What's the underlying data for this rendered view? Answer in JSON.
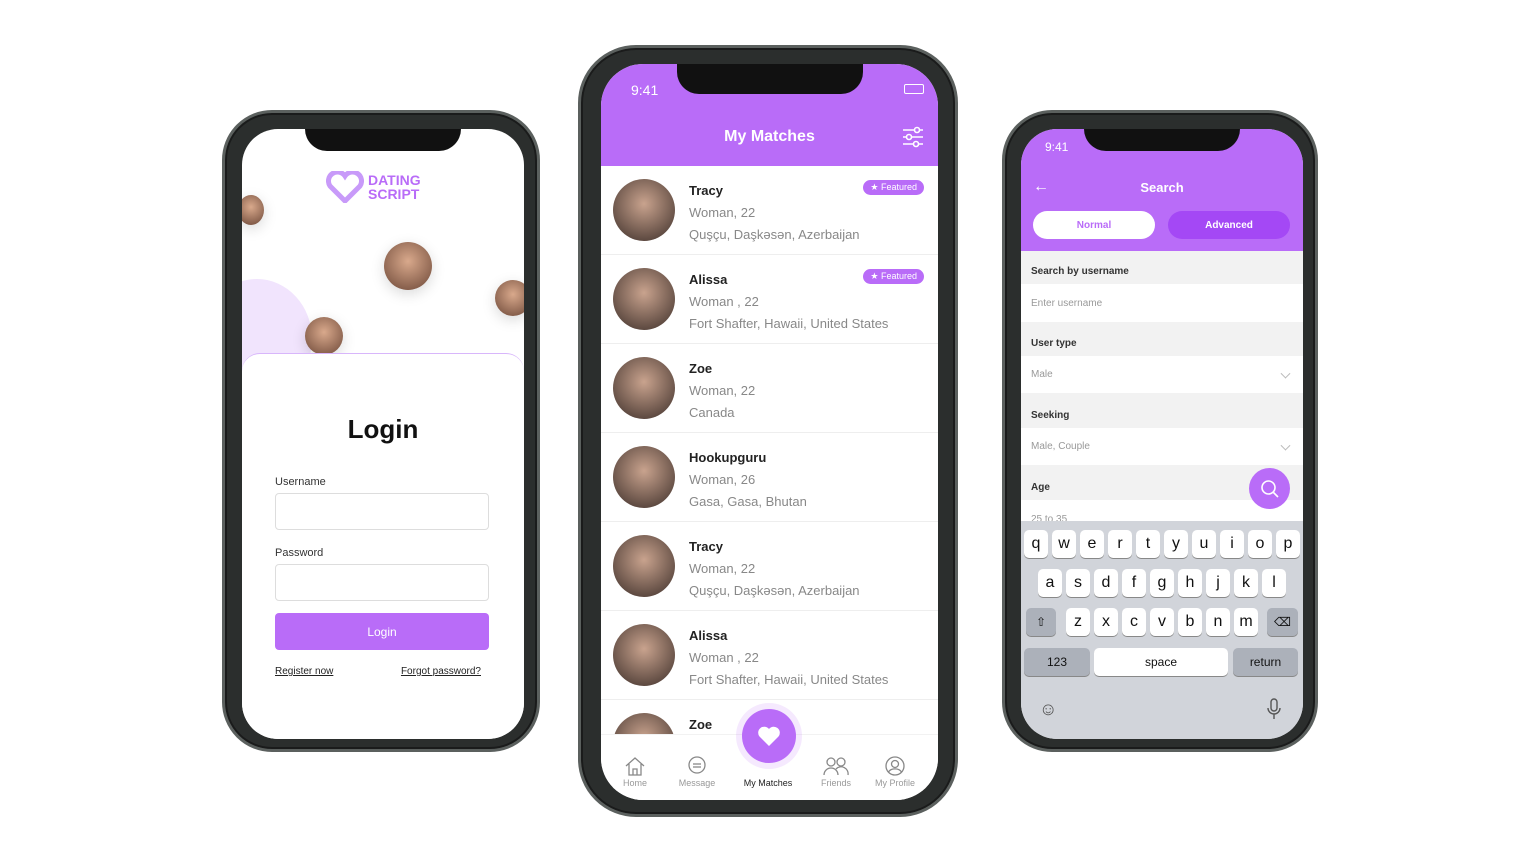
{
  "login_screen": {
    "logo_line1": "DATING",
    "logo_line2": "SCRIPT",
    "title": "Login",
    "username_label": "Username",
    "password_label": "Password",
    "login_button": "Login",
    "register_link": "Register now",
    "forgot_link": "Forgot password?"
  },
  "matches_screen": {
    "time": "9:41",
    "title": "My Matches",
    "icons": {
      "filter": "sliders-icon",
      "fab": "heart-icon"
    },
    "featured_label": "★ Featured",
    "items": [
      {
        "name": "Tracy",
        "detail": "Woman,  22",
        "location": "Quşçu, Daşkəsən, Azerbaijan",
        "featured": true
      },
      {
        "name": "Alissa",
        "detail": "Woman ,  22",
        "location": "Fort Shafter, Hawaii, United States",
        "featured": true
      },
      {
        "name": "Zoe",
        "detail": "Woman,  22",
        "location": "Canada",
        "featured": false
      },
      {
        "name": "Hookupguru",
        "detail": "Woman,  26",
        "location": "Gasa, Gasa, Bhutan",
        "featured": false
      },
      {
        "name": "Tracy",
        "detail": "Woman,  22",
        "location": "Quşçu, Daşkəsən, Azerbaijan",
        "featured": false
      },
      {
        "name": "Alissa",
        "detail": "Woman ,  22",
        "location": "Fort Shafter, Hawaii, United States",
        "featured": false
      },
      {
        "name": "Zoe",
        "detail": "",
        "location": "",
        "featured": false
      }
    ],
    "tabs": [
      {
        "label": "Home"
      },
      {
        "label": "Message"
      },
      {
        "label": "My Matches"
      },
      {
        "label": "Friends"
      },
      {
        "label": "My Profile"
      }
    ],
    "active_tab": "My Matches"
  },
  "search_screen": {
    "time": "9:41",
    "title": "Search",
    "tab_normal": "Normal",
    "tab_advanced": "Advanced",
    "active_tab": "Normal",
    "username_label": "Search by username",
    "username_placeholder": "Enter username",
    "usertype_label": "User type",
    "usertype_value": "Male",
    "seeking_label": "Seeking",
    "seeking_value": "Male, Couple",
    "age_label": "Age",
    "age_value": "25 to 35",
    "keyboard": {
      "row1": [
        "q",
        "w",
        "e",
        "r",
        "t",
        "y",
        "u",
        "i",
        "o",
        "p"
      ],
      "row2": [
        "a",
        "s",
        "d",
        "f",
        "g",
        "h",
        "j",
        "k",
        "l"
      ],
      "row3": [
        "z",
        "x",
        "c",
        "v",
        "b",
        "n",
        "m"
      ],
      "numbers": "123",
      "space": "space",
      "return": "return"
    }
  },
  "colors": {
    "accent": "#b96cf8"
  }
}
